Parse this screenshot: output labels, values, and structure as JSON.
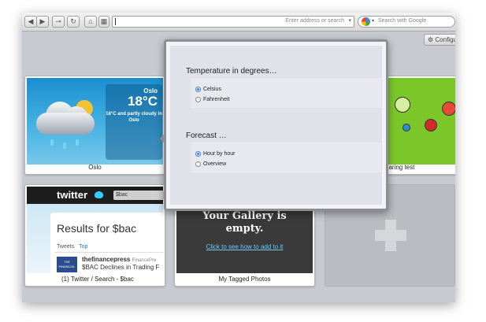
{
  "toolbar": {
    "back_glyph": "◀",
    "forward_glyph": "▶",
    "key_glyph": "⊸",
    "reload_glyph": "↻",
    "home_glyph": "⌂",
    "speeddial_glyph": "▦",
    "address_placeholder": "Enter address or search",
    "search_placeholder": "Search with Google"
  },
  "configure_label": "Configure",
  "tiles": {
    "oslo": {
      "caption": "Oslo",
      "city": "Oslo",
      "temp": "18°C",
      "desc": "18°C and partly cloudy in Oslo"
    },
    "kids": {
      "caption": "sharing test"
    },
    "twitter": {
      "caption": "(1) Twitter / Search - $bac",
      "logo": "twitter",
      "search_value": "$bac",
      "results_heading": "Results for $bac",
      "tab_tweets": "Tweets",
      "tab_top": "Top",
      "avatar_text": "THE FINANCIAL",
      "tweet_user": "thefinancepress",
      "tweet_name": "FinancePre",
      "tweet_text": "$BAC Declines in Trading F"
    },
    "gallery": {
      "caption": "My Tagged Photos",
      "heading_line1": "Your Gallery is",
      "heading_line2": "empty.",
      "link": "Click to see how to add to it"
    }
  },
  "popup": {
    "temperature": {
      "title": "Temperature in degrees…",
      "options": [
        "Celsius",
        "Fahrenheit"
      ],
      "selected": "Celsius"
    },
    "forecast": {
      "title": "Forecast …",
      "options": [
        "Hour by hour",
        "Overview"
      ],
      "selected": "Hour by hour"
    }
  },
  "colors": {
    "accent_radio": "#3a7bd5",
    "link": "#6ec9ff",
    "kids_bg": "#7bc72a"
  }
}
